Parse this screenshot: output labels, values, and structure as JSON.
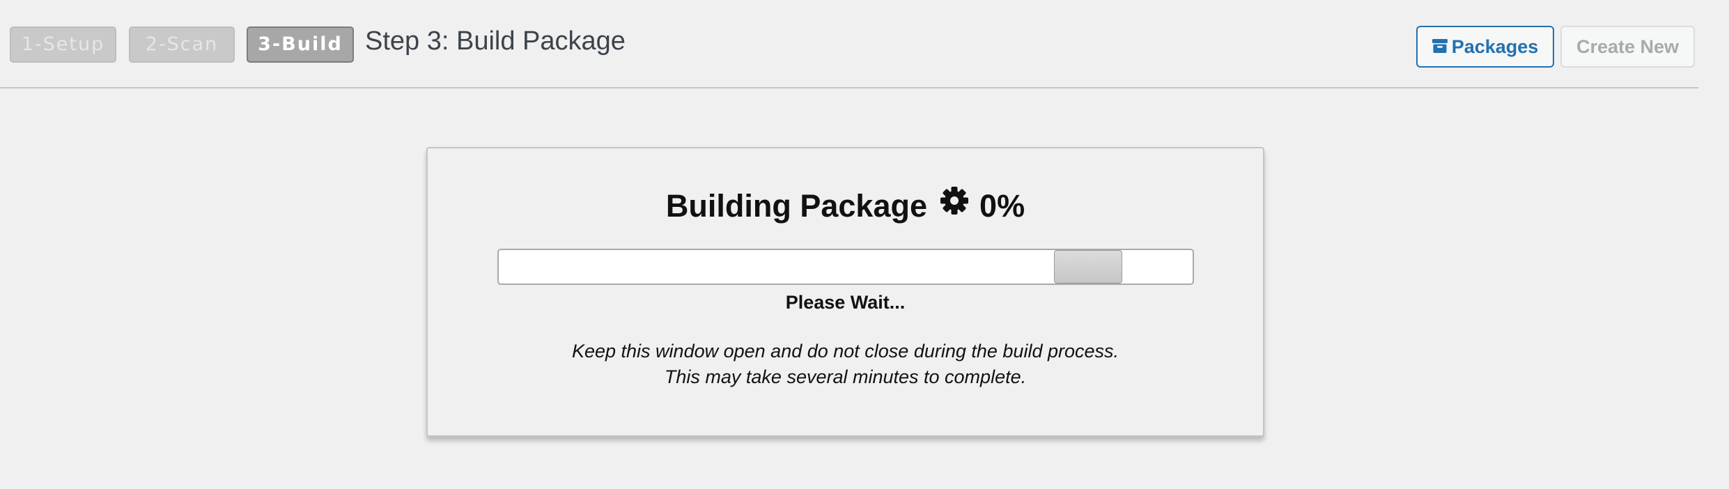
{
  "steps": [
    {
      "label": "1-Setup",
      "state": "inactive"
    },
    {
      "label": "2-Scan",
      "state": "inactive"
    },
    {
      "label": "3-Build",
      "state": "active"
    }
  ],
  "step_title": "Step 3: Build Package",
  "buttons": {
    "packages_label": "Packages",
    "packages_icon": "archive-box-icon",
    "create_new_label": "Create New"
  },
  "panel": {
    "title": "Building Package",
    "title_icon": "gear-icon",
    "percent": "0%",
    "progress_bar_state": "indeterminate",
    "status": "Please Wait...",
    "note_line1": "Keep this window open and do not close during the build process.",
    "note_line2": "This may take several minutes to complete."
  },
  "colors": {
    "page_background": "#f0f0f1",
    "accent_blue": "#2271b1",
    "active_step_bg": "#a7a7a7",
    "inactive_step_bg": "#c9c9c9",
    "disabled_text": "#a7aaad"
  }
}
